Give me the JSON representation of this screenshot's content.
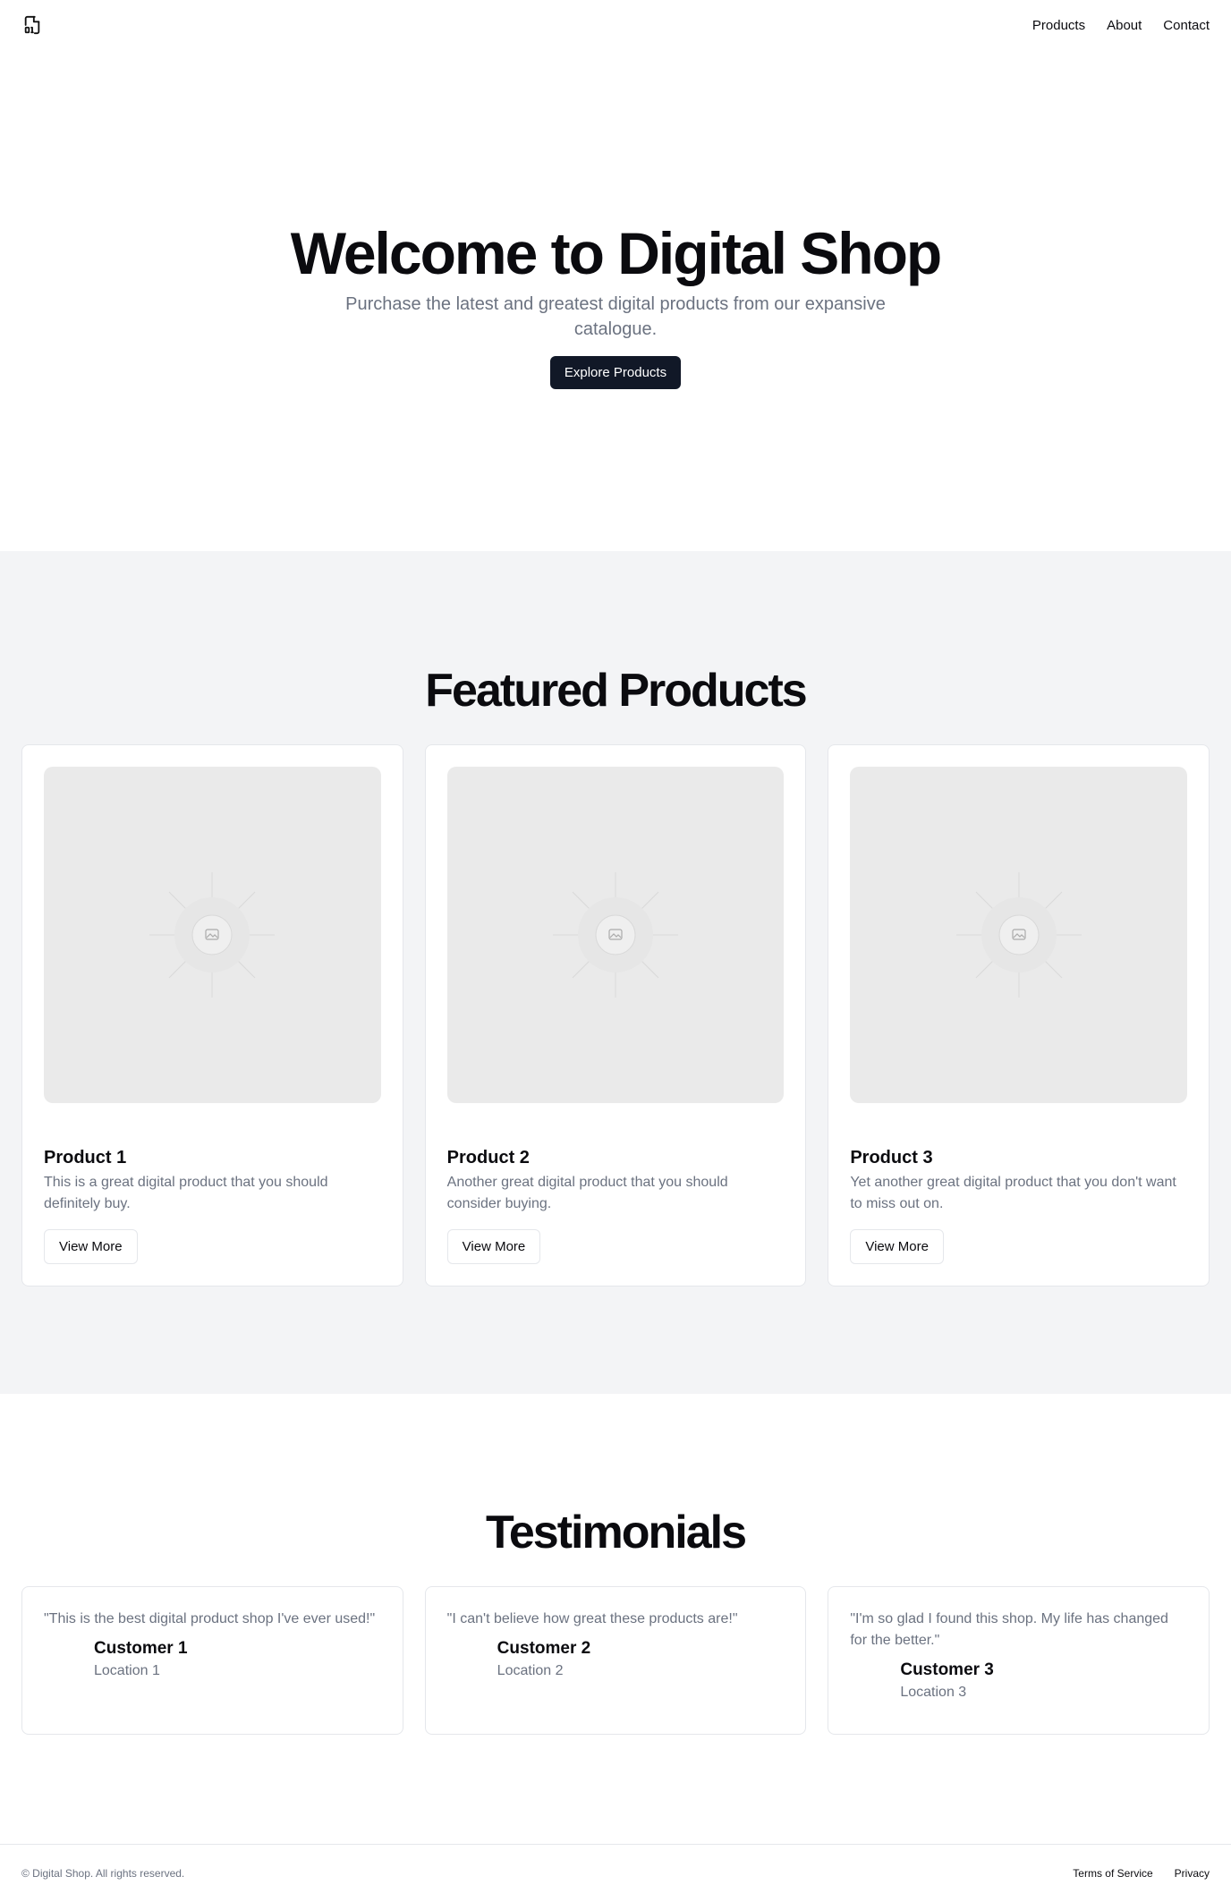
{
  "header": {
    "logo_icon": "file-binary-icon",
    "nav": [
      {
        "label": "Products"
      },
      {
        "label": "About"
      },
      {
        "label": "Contact"
      }
    ]
  },
  "hero": {
    "title": "Welcome to Digital Shop",
    "subtitle": "Purchase the latest and greatest digital products from our expansive catalogue.",
    "cta_label": "Explore Products"
  },
  "featured": {
    "title": "Featured Products",
    "products": [
      {
        "name": "Product 1",
        "description": "This is a great digital product that you should definitely buy.",
        "button_label": "View More",
        "image_icon": "image-placeholder-icon"
      },
      {
        "name": "Product 2",
        "description": "Another great digital product that you should consider buying.",
        "button_label": "View More",
        "image_icon": "image-placeholder-icon"
      },
      {
        "name": "Product 3",
        "description": "Yet another great digital product that you don't want to miss out on.",
        "button_label": "View More",
        "image_icon": "image-placeholder-icon"
      }
    ]
  },
  "testimonials": {
    "title": "Testimonials",
    "items": [
      {
        "quote": "\"This is the best digital product shop I've ever used!\"",
        "name": "Customer 1",
        "location": "Location 1"
      },
      {
        "quote": "\"I can't believe how great these products are!\"",
        "name": "Customer 2",
        "location": "Location 2"
      },
      {
        "quote": "\"I'm so glad I found this shop. My life has changed for the better.\"",
        "name": "Customer 3",
        "location": "Location 3"
      }
    ]
  },
  "footer": {
    "copyright": "© Digital Shop. All rights reserved.",
    "links": [
      {
        "label": "Terms of Service"
      },
      {
        "label": "Privacy"
      }
    ]
  },
  "colors": {
    "primary_button": "#111827",
    "section_bg": "#f3f4f6",
    "muted_text": "#6b7280",
    "border": "#e5e7eb"
  }
}
